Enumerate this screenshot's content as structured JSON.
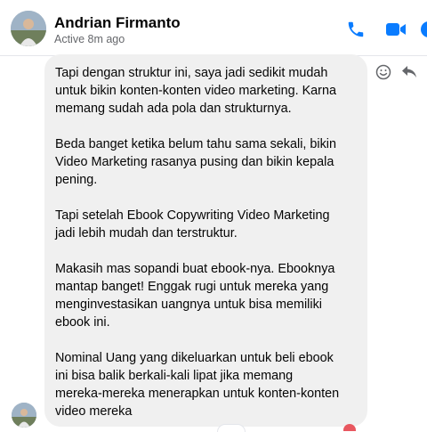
{
  "header": {
    "name": "Andrian Firmanto",
    "status": "Active 8m ago",
    "icons": [
      "phone-icon",
      "video-call-icon",
      "info-icon"
    ],
    "accent_color": "#0a7cff"
  },
  "message": {
    "text": "Tapi dengan struktur ini, saya jadi sedikit mudah\nuntuk bikin konten-konten video marketing. Karna\nmemang sudah ada pola dan strukturnya.\n\nBeda banget ketika belum tahu sama sekali, bikin\nVideo Marketing rasanya pusing dan bikin kepala\npening.\n\nTapi setelah Ebook Copywriting Video Marketing\njadi lebih mudah dan terstruktur.\n\nMakasih mas sopandi buat ebook-nya. Ebooknya\nmantap banget! Enggak rugi untuk mereka yang\nmenginvestasikan uangnya untuk bisa memiliki\nebook ini.\n\nNominal Uang yang dikeluarkan untuk beli ebook\nini bisa balik berkali-kali lipat jika memang\nmereka-mereka menerapkan untuk konten-konten\nvideo mereka",
    "bubble_color": "#f0f0f0",
    "actions": [
      "react-icon",
      "reply-icon"
    ]
  }
}
